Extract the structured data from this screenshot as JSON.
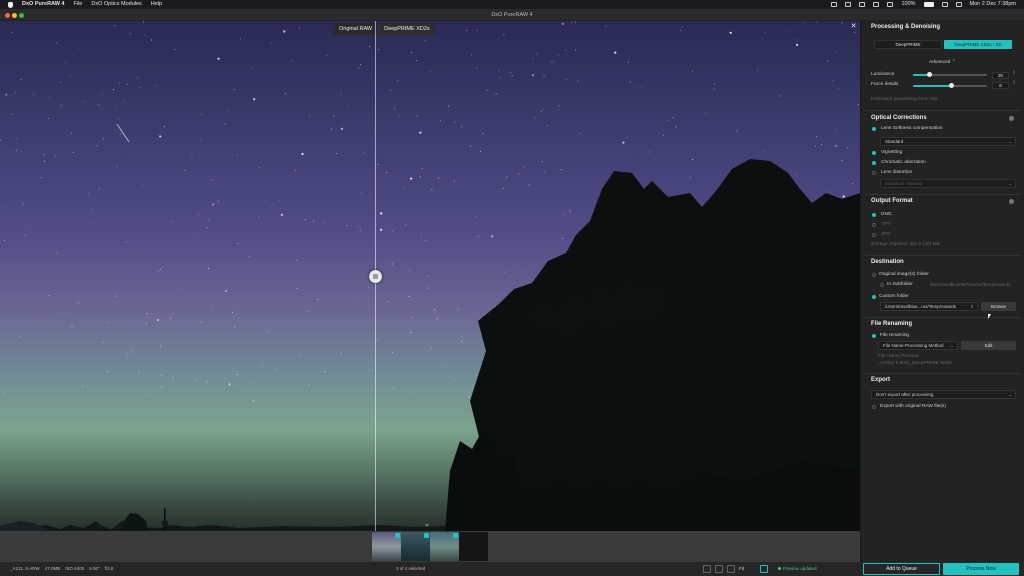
{
  "menubar": {
    "app_name": "DxO PureRAW 4",
    "items": [
      "File",
      "DxO Optics Modules",
      "Help"
    ],
    "battery": "100%",
    "clock": "Mon 2 Dec  7:38pm"
  },
  "window": {
    "title": "DxO PureRAW 4",
    "lights": [
      "#fe5f57",
      "#febc2e",
      "#28c840"
    ]
  },
  "compare": {
    "left_label": "Original RAW",
    "right_label": "DeepPRIME XD2s",
    "close": "✕"
  },
  "filmstrip": {
    "collapse_icon": "⌄",
    "thumbnails": [
      {
        "name": "thumb-1",
        "colors": [
          "#5a5a82",
          "#8e9aa0",
          "#3c4650"
        ]
      },
      {
        "name": "thumb-2",
        "colors": [
          "#3e5a5e",
          "#27424a",
          "#1b2a2e"
        ]
      },
      {
        "name": "thumb-3",
        "colors": [
          "#4c6a78",
          "#6e8f8a",
          "#3b4a44"
        ]
      }
    ]
  },
  "statusbar": {
    "meta": [
      "_A131..6.ARW",
      "47.0MB",
      "ISO 6400",
      "5.00\"",
      "f/2.8"
    ],
    "selection": "3 of 4 selected",
    "zoom": "Fit",
    "preview_status": "Preview updated",
    "add_queue": "Add to Queue",
    "process_now": "Process Now"
  },
  "panel": {
    "processing": {
      "title": "Processing & Denoising",
      "method_a": "DeepPRIME",
      "method_b": "DeepPRIME XD2s / XD",
      "advanced": "Advanced ⌃",
      "luminance_label": "Luminance",
      "luminance_value": "30",
      "luminance_level": 0.22,
      "force_label": "Force details",
      "force_value": "8",
      "force_level": 0.52,
      "estimated": "Estimated processing time: 20s"
    },
    "optical": {
      "title": "Optical Corrections",
      "lens_softness": "Lens Softness compensation",
      "lens_mode": "Standard",
      "vignetting": "Vignetting",
      "chromatic": "Chromatic aberration",
      "distortion": "Lens distortion",
      "distortion_mode": "Maximum retained"
    },
    "output": {
      "title": "Output Format",
      "dng": "DNG",
      "tiff": "TIFF",
      "jpg": "JPG",
      "storage": "Storage required: 351.0 (30) MB"
    },
    "destination": {
      "title": "Destination",
      "original_folder": "Original image(s) folder",
      "in_subfolder": "In Subfolder",
      "subfolder_path": "/sers/ravelblue09/Pictures/Temp/Awards",
      "custom_folder": "Custom folder",
      "custom_path": "/Users/ravelblue...ros/Temp/Awards",
      "browse": "Browse"
    },
    "renaming": {
      "title": "File Renaming",
      "file_renaming": "File renaming",
      "pattern": "File Name-Processing Method",
      "edit": "Edit",
      "preview_label": "File Name Preview:",
      "preview_value": "_A7311-6.DxO_DeepPRIME XD2s"
    },
    "export": {
      "title": "Export",
      "mode": "Don't export after processing",
      "with_raw": "Export with original RAW file(s)"
    }
  },
  "colors": {
    "accent": "#20c3c2",
    "preview_ok": "#3dd17d"
  }
}
